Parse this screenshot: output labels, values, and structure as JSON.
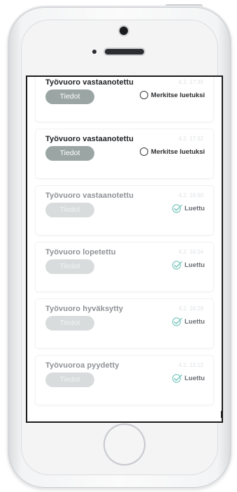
{
  "colors": {
    "accent_button": "#9aa5a4",
    "faded_button": "#d8dcdd",
    "check_color": "#7fc8c0",
    "screen_border": "#1b1b1b"
  },
  "notifications": [
    {
      "title": "Työvuoro vastaanotettu",
      "time": "4.2. 17:39",
      "button_label": "Tiedot",
      "status": "unread",
      "mark_label": "Merkitse luetuksi",
      "icon": "radio-unchecked-icon"
    },
    {
      "title": "Työvuoro vastaanotettu",
      "time": "4.2. 17:32",
      "button_label": "Tiedot",
      "status": "unread",
      "mark_label": "Merkitse luetuksi",
      "icon": "radio-unchecked-icon"
    },
    {
      "title": "Työvuoro vastaanotettu",
      "time": "4.2. 16:50",
      "button_label": "Tiedot",
      "status": "read",
      "read_label": "Luettu",
      "icon": "check-icon"
    },
    {
      "title": "Työvuoro lopetettu",
      "time": "4.2. 16:04",
      "button_label": "Tiedot",
      "status": "read",
      "read_label": "Luettu",
      "icon": "check-icon"
    },
    {
      "title": "Työvuoro hyväksytty",
      "time": "4.2. 16:28",
      "button_label": "Tiedot",
      "status": "read",
      "read_label": "Luettu",
      "icon": "check-icon"
    },
    {
      "title": "Työvuoroa pyydetty",
      "time": "4.2. 13:12",
      "button_label": "Tiedot",
      "status": "read",
      "read_label": "Luettu",
      "icon": "check-icon"
    }
  ]
}
